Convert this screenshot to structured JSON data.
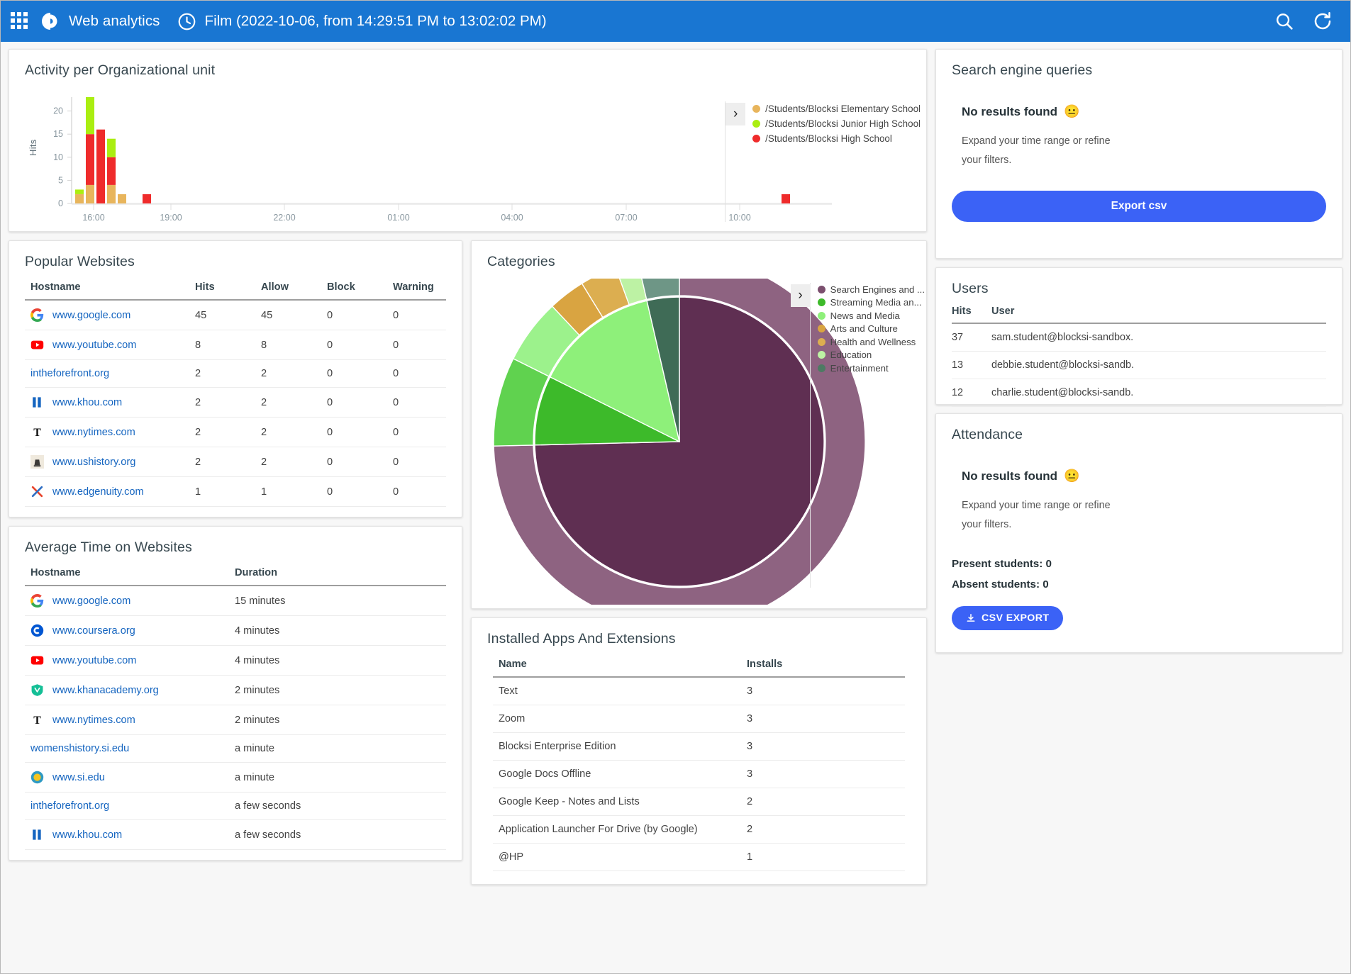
{
  "header": {
    "app_title": "Web analytics",
    "range_title": "Film (2022-10-06, from 14:29:51 PM to 13:02:02 PM)",
    "apps_icon": "grid-apps-icon",
    "brand_icon": "blocksi-logo-icon",
    "clock_icon": "clock-icon",
    "search_icon": "search-icon",
    "refresh_icon": "refresh-icon"
  },
  "activity": {
    "title": "Activity per Organizational unit",
    "expand_arrow": "›",
    "legend": [
      {
        "label": "/Students/Blocksi Elementary School",
        "color": "#e8b55c"
      },
      {
        "label": "/Students/Blocksi Junior High School",
        "color": "#aaee11"
      },
      {
        "label": "/Students/Blocksi High School",
        "color": "#ef2b2b"
      }
    ]
  },
  "popular_websites": {
    "title": "Popular Websites",
    "columns": [
      "Hostname",
      "Hits",
      "Allow",
      "Block",
      "Warning"
    ],
    "rows": [
      {
        "icon": "google-favicon",
        "host": "www.google.com",
        "hits": "45",
        "allow": "45",
        "block": "0",
        "warning": "0"
      },
      {
        "icon": "youtube-favicon",
        "host": "www.youtube.com",
        "hits": "8",
        "allow": "8",
        "block": "0",
        "warning": "0"
      },
      {
        "icon": "none",
        "host": "intheforefront.org",
        "hits": "2",
        "allow": "2",
        "block": "0",
        "warning": "0"
      },
      {
        "icon": "khou-favicon",
        "host": "www.khou.com",
        "hits": "2",
        "allow": "2",
        "block": "0",
        "warning": "0"
      },
      {
        "icon": "nytimes-favicon",
        "host": "www.nytimes.com",
        "hits": "2",
        "allow": "2",
        "block": "0",
        "warning": "0"
      },
      {
        "icon": "ushistory-favicon",
        "host": "www.ushistory.org",
        "hits": "2",
        "allow": "2",
        "block": "0",
        "warning": "0"
      },
      {
        "icon": "edgenuity-favicon",
        "host": "www.edgenuity.com",
        "hits": "1",
        "allow": "1",
        "block": "0",
        "warning": "0"
      }
    ]
  },
  "average_time": {
    "title": "Average Time on Websites",
    "columns": [
      "Hostname",
      "Duration"
    ],
    "rows": [
      {
        "icon": "google-favicon",
        "host": "www.google.com",
        "duration": "15 minutes"
      },
      {
        "icon": "coursera-favicon",
        "host": "www.coursera.org",
        "duration": "4 minutes"
      },
      {
        "icon": "youtube-favicon",
        "host": "www.youtube.com",
        "duration": "4 minutes"
      },
      {
        "icon": "khanacademy-favicon",
        "host": "www.khanacademy.org",
        "duration": "2 minutes"
      },
      {
        "icon": "nytimes-favicon",
        "host": "www.nytimes.com",
        "duration": "2 minutes"
      },
      {
        "icon": "none",
        "host": "womenshistory.si.edu",
        "duration": "a minute"
      },
      {
        "icon": "siedu-favicon",
        "host": "www.si.edu",
        "duration": "a minute"
      },
      {
        "icon": "none",
        "host": "intheforefront.org",
        "duration": "a few seconds"
      },
      {
        "icon": "khou-favicon",
        "host": "www.khou.com",
        "duration": "a few seconds"
      }
    ]
  },
  "categories": {
    "title": "Categories",
    "expand_arrow": "›",
    "legend": [
      {
        "label": "Search Engines and ...",
        "color": "#7b4f6e"
      },
      {
        "label": "Streaming Media an...",
        "color": "#3dba2a"
      },
      {
        "label": "News and Media",
        "color": "#8ef07a"
      },
      {
        "label": "Arts and Culture",
        "color": "#d9a441"
      },
      {
        "label": "Health and Wellness",
        "color": "#dcae50"
      },
      {
        "label": "Education",
        "color": "#bdf2a4"
      },
      {
        "label": "Entertainment",
        "color": "#4d7a63"
      }
    ]
  },
  "installed_apps": {
    "title": "Installed Apps And Extensions",
    "columns": [
      "Name",
      "Installs"
    ],
    "rows": [
      {
        "name": "Text",
        "installs": "3"
      },
      {
        "name": "Zoom",
        "installs": "3"
      },
      {
        "name": "Blocksi Enterprise Edition",
        "installs": "3"
      },
      {
        "name": "Google Docs Offline",
        "installs": "3"
      },
      {
        "name": "Google Keep - Notes and Lists",
        "installs": "2"
      },
      {
        "name": "Application Launcher For Drive (by Google)",
        "installs": "2"
      },
      {
        "name": "@HP",
        "installs": "1"
      }
    ]
  },
  "search_queries": {
    "title": "Search engine queries",
    "no_results": "No results found",
    "emoji": "😐",
    "hint": "Expand your time range or refine your filters.",
    "export_label": "Export csv"
  },
  "users": {
    "title": "Users",
    "columns": [
      "Hits",
      "User"
    ],
    "rows": [
      {
        "hits": "37",
        "user": "sam.student@blocksi-sandbox...."
      },
      {
        "hits": "13",
        "user": "debbie.student@blocksi-sandb..."
      },
      {
        "hits": "12",
        "user": "charlie.student@blocksi-sandb..."
      }
    ]
  },
  "attendance": {
    "title": "Attendance",
    "no_results": "No results found",
    "emoji": "😐",
    "hint": "Expand your time range or refine your filters.",
    "present": "Present students: 0",
    "absent": "Absent students: 0",
    "export_label": "CSV EXPORT",
    "download_icon": "download-icon"
  },
  "chart_data": [
    {
      "type": "bar",
      "title": "Activity per Organizational unit",
      "xlabel": "",
      "ylabel": "Hits",
      "ylim": [
        0,
        23
      ],
      "yticks": [
        0,
        5,
        10,
        15,
        20
      ],
      "xticks": [
        "16:00",
        "19:00",
        "22:00",
        "01:00",
        "04:00",
        "07:00",
        "10:00"
      ],
      "stacked": true,
      "grid": false,
      "legend_position": "right",
      "categories": [
        "14:30",
        "14:45",
        "15:00",
        "15:15",
        "15:30",
        "15:55",
        "11:45"
      ],
      "series": [
        {
          "name": "/Students/Blocksi Elementary School",
          "color": "#e8b55c",
          "values": [
            2,
            4,
            0,
            4,
            2,
            0
          ]
        },
        {
          "name": "/Students/Blocksi High School",
          "color": "#ef2b2b",
          "values": [
            0,
            11,
            16,
            6,
            0,
            2
          ]
        },
        {
          "name": "/Students/Blocksi Junior High School",
          "color": "#aaee11",
          "values": [
            1,
            8,
            0,
            4,
            0,
            0
          ]
        }
      ],
      "bar_totals": [
        3,
        23,
        16,
        14,
        2,
        2
      ]
    },
    {
      "type": "pie",
      "title": "Categories",
      "variant": "nested-sunburst",
      "legend_position": "right",
      "inner_ring": [
        {
          "label": "Search Engines and ...",
          "value": 74.5,
          "color": "#5f2f52"
        },
        {
          "label": "Entertainment",
          "value": 3.6,
          "color": "#3f6b56"
        },
        {
          "label": "News and Media",
          "value": 14.0,
          "color": "#8ef07a"
        },
        {
          "label": "Streaming Media an...",
          "value": 7.9,
          "color": "#3dba2a"
        }
      ],
      "outer_ring": [
        {
          "label": "Search Engines and ...",
          "value": 74.5,
          "color": "#8e6381"
        },
        {
          "label": "Entertainment",
          "value": 3.6,
          "color": "#6e9686"
        },
        {
          "label": "Education",
          "value": 2.0,
          "color": "#bdf2a4"
        },
        {
          "label": "Health and Wellness",
          "value": 3.2,
          "color": "#dcae50"
        },
        {
          "label": "Arts and Culture",
          "value": 3.2,
          "color": "#d9a441"
        },
        {
          "label": "News and Media",
          "value": 5.6,
          "color": "#9cf28c"
        },
        {
          "label": "Streaming Media an...",
          "value": 7.9,
          "color": "#60d24f"
        }
      ]
    }
  ]
}
